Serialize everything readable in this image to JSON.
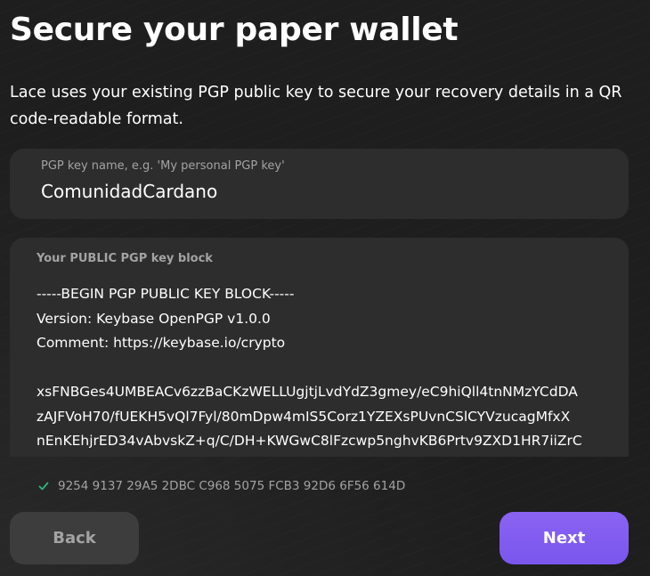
{
  "header": {
    "title": "Secure your paper wallet"
  },
  "description": "Lace uses your existing PGP public key to secure your recovery details in a QR code-readable format.",
  "pgp_name_field": {
    "label": "PGP key name, e.g. 'My personal PGP key'",
    "value": "ComunidadCardano"
  },
  "pgp_key_field": {
    "label": "Your PUBLIC PGP key block",
    "value": "-----BEGIN PGP PUBLIC KEY BLOCK-----\nVersion: Keybase OpenPGP v1.0.0\nComment: https://keybase.io/crypto\n\nxsFNBGes4UMBEACv6zzBaCKzWELLUgjtjLvdYdZ3gmey/eC9hiQll4tnNMzYCdDA\nzAJFVoH70/fUEKH5vQl7Fyl/80mDpw4mIS5Corz1YZEXsPUvnCSlCYVzucagMfxX\nnEnKEhjrED34vAbvskZ+q/C/DH+KWGwC8lFzcwp5nghvKB6Prtv9ZXD1HR7iiZrC"
  },
  "fingerprint": {
    "icon": "check-icon",
    "value": "9254 9137 29A5 2DBC C968 5075 FCB3 92D6 6F56 614D",
    "color": "#2cb67d"
  },
  "buttons": {
    "back_label": "Back",
    "next_label": "Next"
  },
  "colors": {
    "background": "#1e1e1e",
    "field": "#2d2d2d",
    "accent": "#7f5af0",
    "muted_text": "#a3a3a3"
  }
}
